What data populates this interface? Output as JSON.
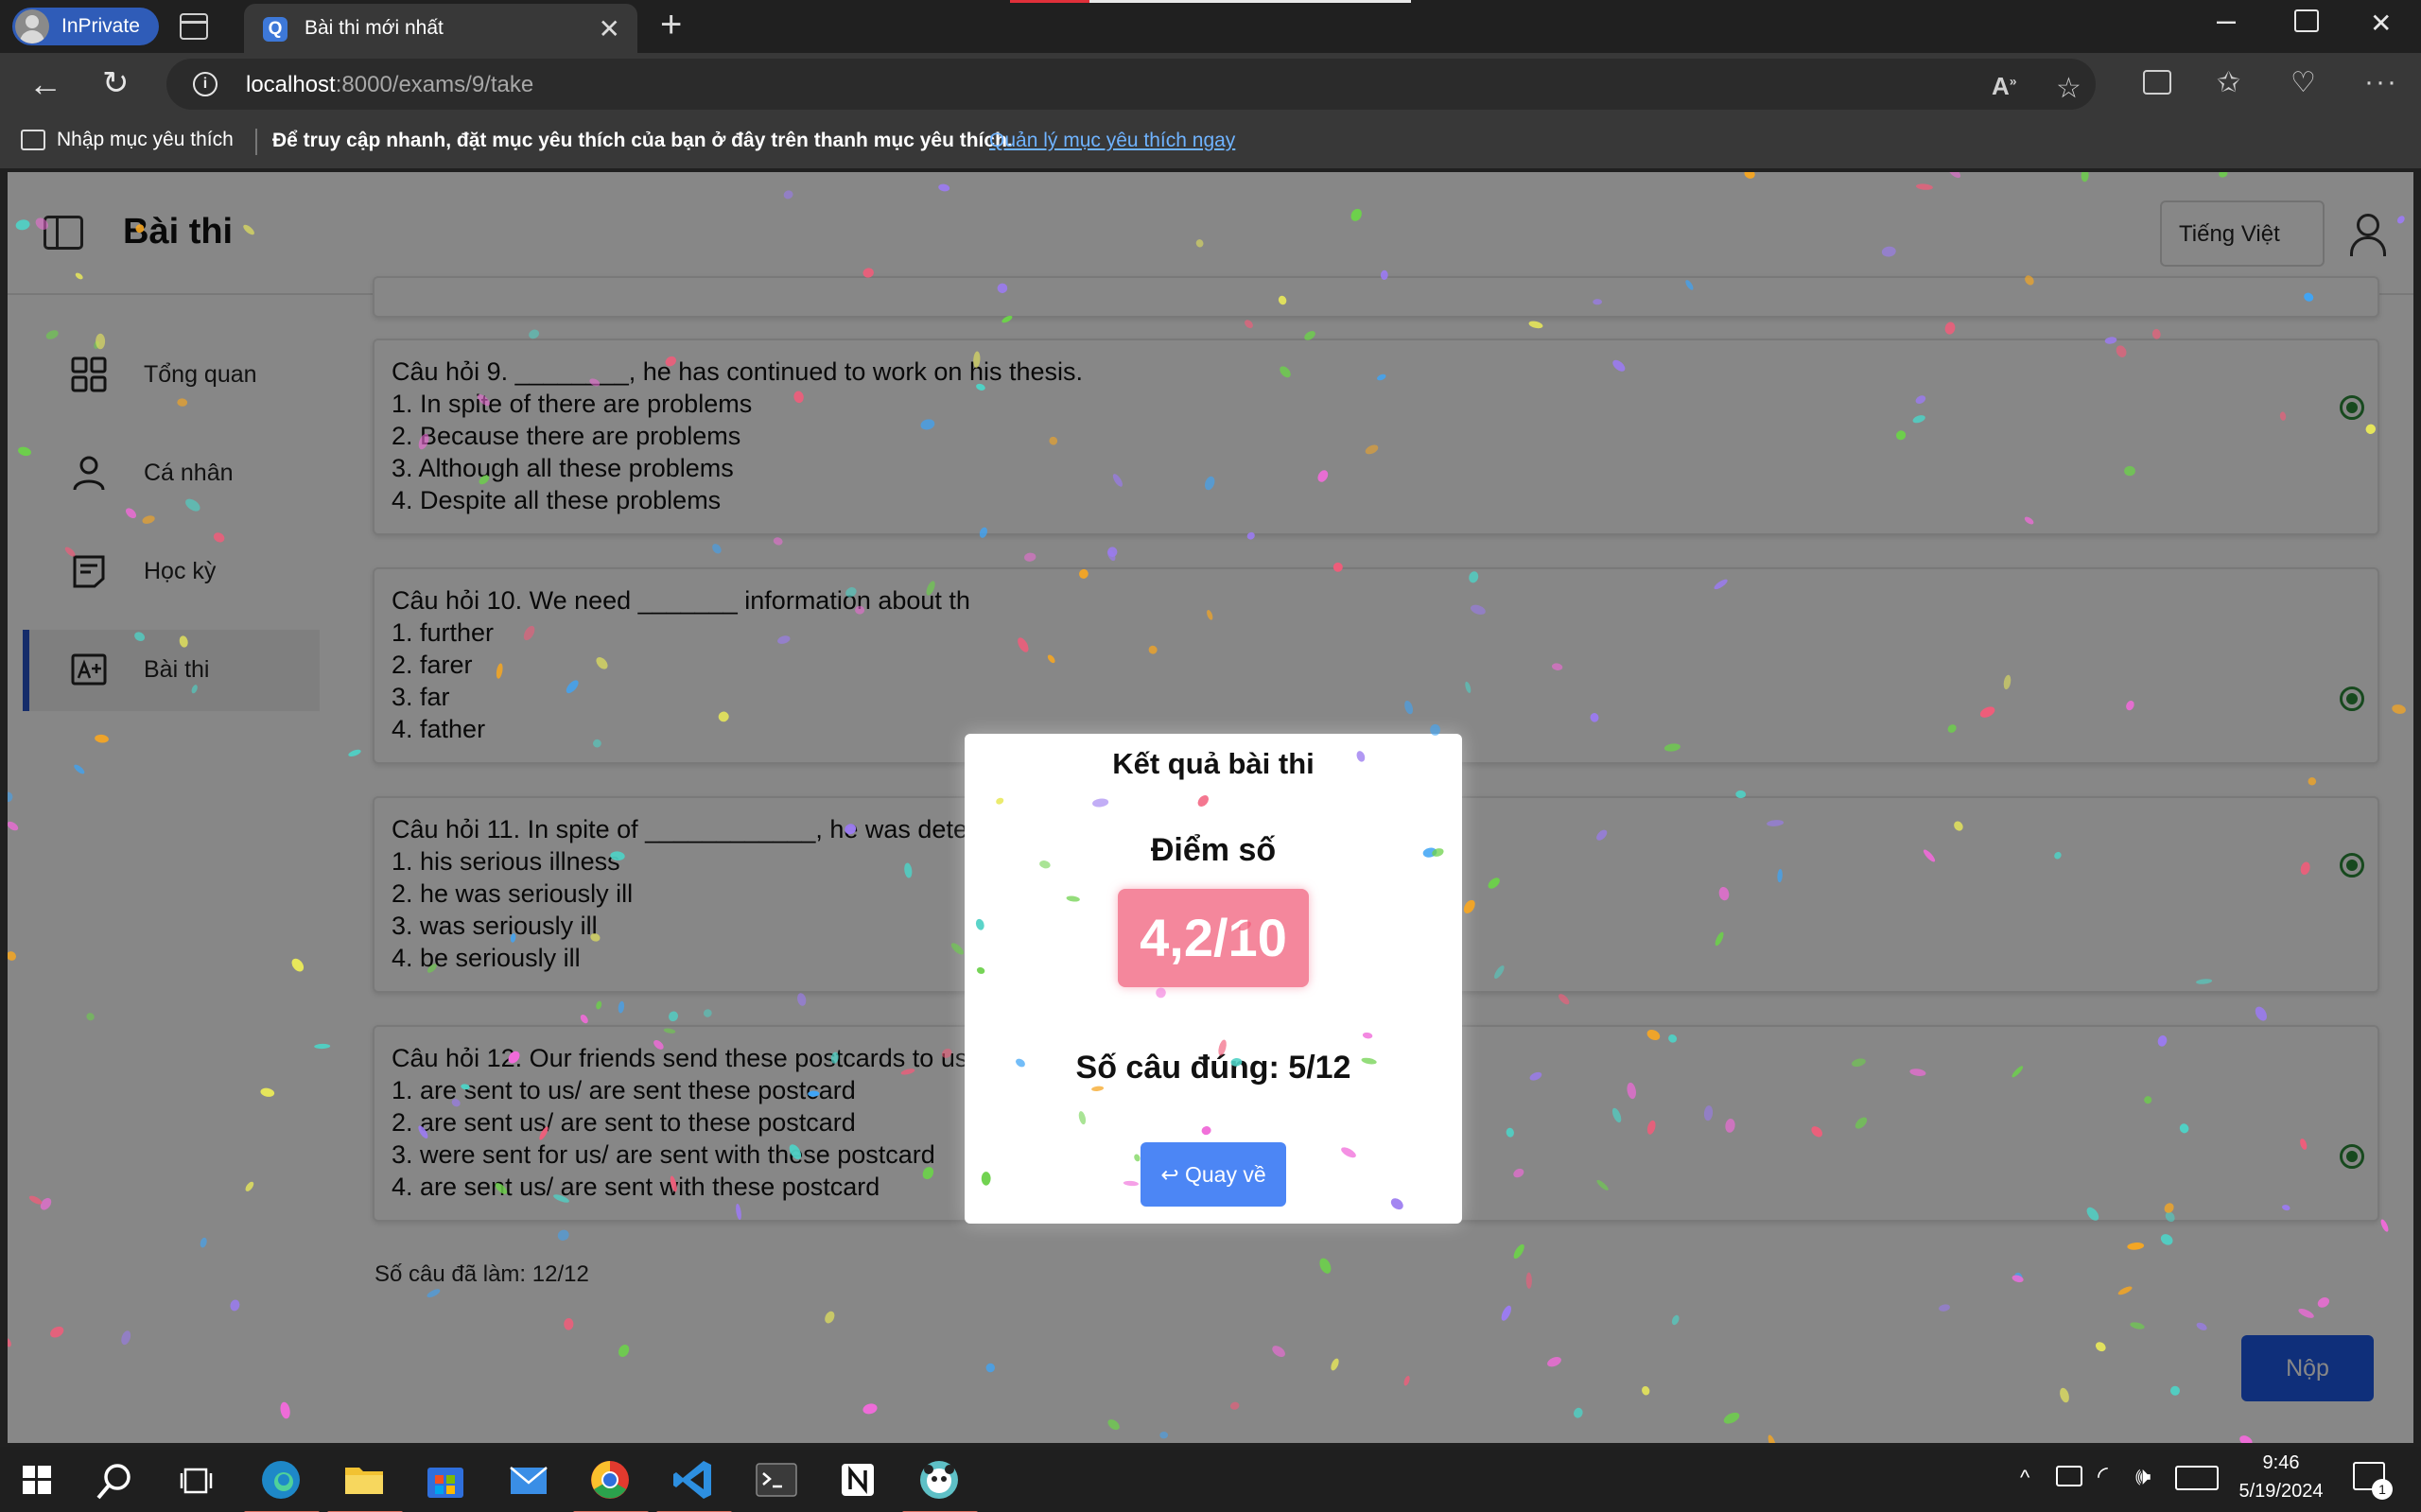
{
  "browser": {
    "inprivate_label": "InPrivate",
    "tab_title": "Bài thi mới nhất",
    "tab_favicon": "Q",
    "new_tab_symbol": "+",
    "close_symbol": "✕",
    "url_host": "localhost",
    "url_path": ":8000/exams/9/take",
    "favorites": {
      "import_label": "Nhập mục yêu thích",
      "message": "Để truy cập nhanh, đặt mục yêu thích của bạn ở đây trên thanh mục yêu thích.",
      "manage_link": "Quản lý mục yêu thích ngay"
    }
  },
  "header": {
    "title": "Bài thi",
    "language": "Tiếng Việt"
  },
  "sidebar": {
    "items": [
      {
        "label": "Tổng quan",
        "icon": "grid-icon"
      },
      {
        "label": "Cá nhân",
        "icon": "user-icon"
      },
      {
        "label": "Học kỳ",
        "icon": "note-icon"
      },
      {
        "label": "Bài thi",
        "icon": "exam-icon",
        "active": true
      }
    ]
  },
  "questions": [
    {
      "question": "Câu hỏi 9. ________, he has continued to work on his thesis.",
      "options": [
        "1. In spite of there are problems",
        "2. Because there are problems",
        "3. Although all these problems",
        "4. Despite all these problems"
      ]
    },
    {
      "question": "Câu hỏi 10. We need _______ information about th",
      "options": [
        "1. further",
        "2. farer",
        "3. far",
        "4. father"
      ]
    },
    {
      "question": "Câu hỏi 11. In spite of ____________, he was determ",
      "options": [
        "1. his serious illness",
        "2. he was seriously ill",
        "3. was seriously ill",
        "4. be seriously ill"
      ]
    },
    {
      "question": "Câu hỏi 12. Our friends send these postcards to us.",
      "options": [
        "1. are sent to us/ are sent these postcard",
        "2. are sent us/ are sent to these postcard",
        "3. were sent for us/ are sent with these postcard",
        "4. are sent us/ are sent with these postcard"
      ]
    }
  ],
  "answered_count": "Số câu đã làm: 12/12",
  "submit_label": "Nộp",
  "modal": {
    "title": "Kết quả bài thi",
    "score_label": "Điểm số",
    "score": "4,2/10",
    "correct": "Số câu đúng: 5/12",
    "back_label": "Quay về",
    "colors": {
      "score_bg": "#f4879c",
      "button_bg": "#4c86f5"
    }
  },
  "taskbar": {
    "time": "9:46",
    "date": "5/19/2024",
    "notification_count": "1"
  }
}
